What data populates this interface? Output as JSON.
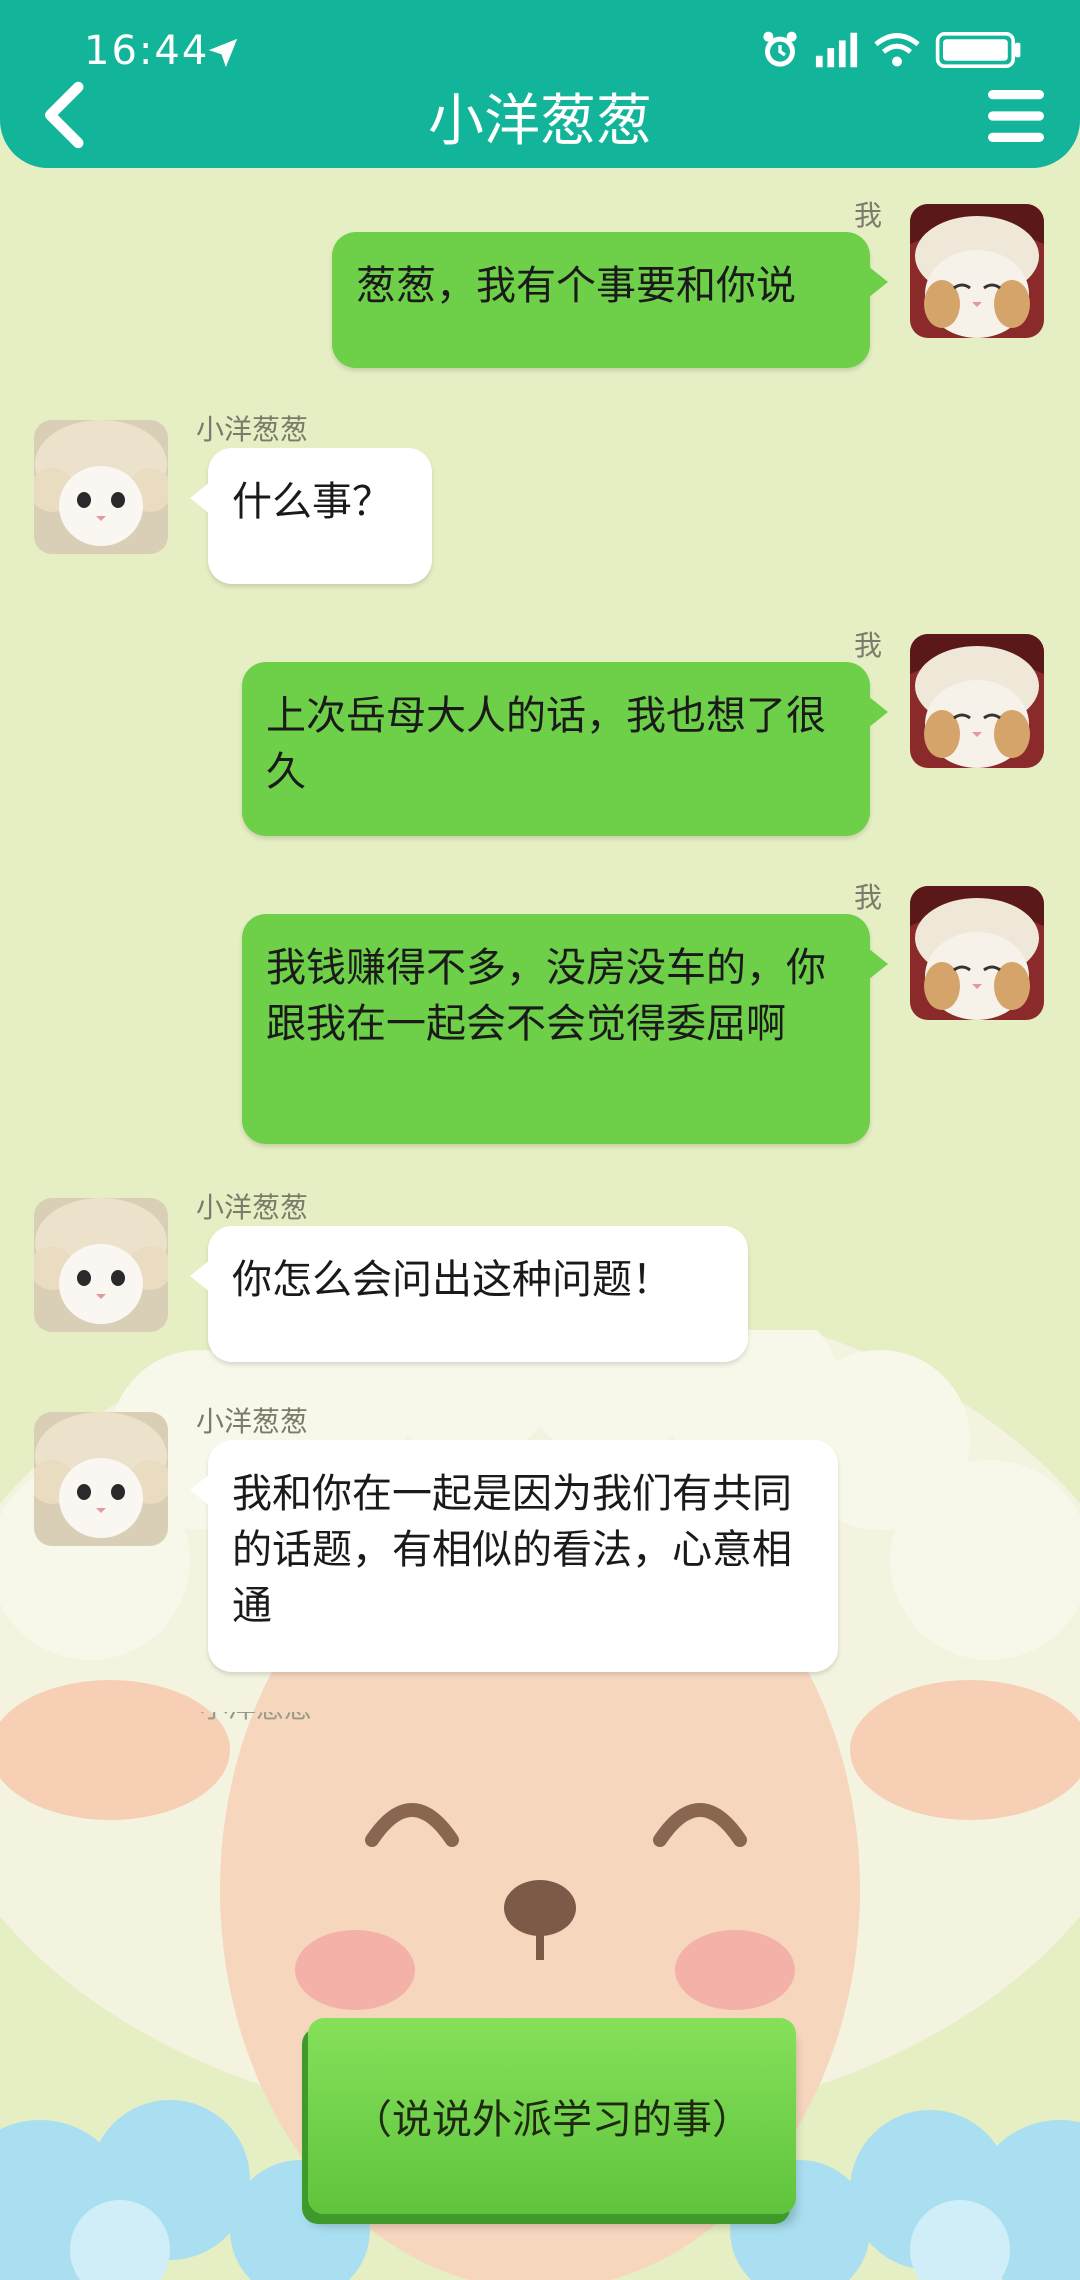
{
  "status_bar": {
    "time": "16:44"
  },
  "header": {
    "title": "小洋葱葱"
  },
  "messages": [
    {
      "side": "right",
      "sender": "我",
      "text": "葱葱，我有个事要和你说"
    },
    {
      "side": "left",
      "sender": "小洋葱葱",
      "text": "什么事？"
    },
    {
      "side": "right",
      "sender": "我",
      "text": "上次岳母大人的话，我也想了很久"
    },
    {
      "side": "right",
      "sender": "我",
      "text": "我钱赚得不多，没房没车的，你跟我在一起会不会觉得委屈啊"
    },
    {
      "side": "left",
      "sender": "小洋葱葱",
      "text": "你怎么会问出这种问题！"
    },
    {
      "side": "left",
      "sender": "小洋葱葱",
      "text": "我和你在一起是因为我们有共同的话题，有相似的看法，心意相通"
    }
  ],
  "partial_sender": "小洋葱葱",
  "action": {
    "label": "（说说外派学习的事）"
  },
  "colors": {
    "header": "#12b49a",
    "background": "#e6eec3",
    "my_bubble": "#6ecf48",
    "their_bubble": "#ffffff"
  },
  "icons": [
    "location-arrow-icon",
    "alarm-icon",
    "signal-icon",
    "wifi-icon",
    "battery-icon",
    "back-icon",
    "menu-icon",
    "cat-avatar-icon"
  ]
}
